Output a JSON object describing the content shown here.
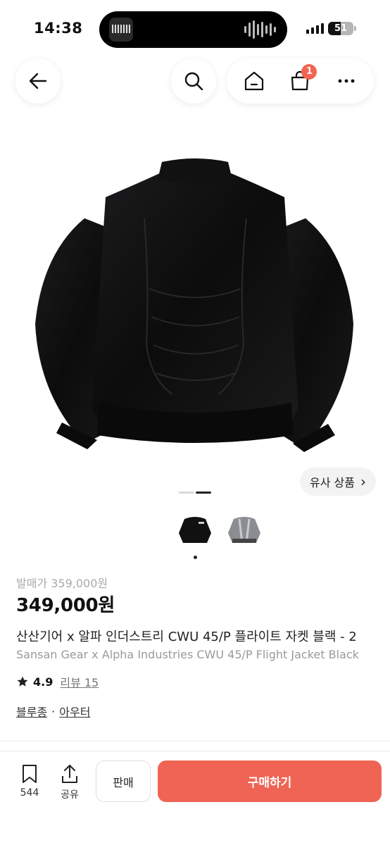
{
  "status_bar": {
    "time": "14:38",
    "battery": "51",
    "battery_level": 0.51
  },
  "nav": {
    "cart_badge": "1"
  },
  "similar_products": {
    "label": "유사 상품",
    "chevron": "›"
  },
  "carousel": {
    "total": 2,
    "active": 1
  },
  "price": {
    "retail_label": "발매가 359,000원",
    "current": "349,000원"
  },
  "product": {
    "title_ko": "산산기어 x 알파 인더스트리 CWU 45/P 플라이트 자켓 블랙 - 2",
    "title_en": "Sansan Gear x Alpha Industries CWU 45/P Flight Jacket Black",
    "rating": "4.9",
    "reviews": "리뷰 15",
    "categories": [
      "블루종",
      "아우터"
    ],
    "category_separator": "·"
  },
  "bottom_bar": {
    "bookmark_count": "544",
    "share_label": "공유",
    "sell_label": "판매",
    "buy_label": "구매하기"
  },
  "colors": {
    "accent": "#ef6454",
    "badge": "#f26552"
  }
}
